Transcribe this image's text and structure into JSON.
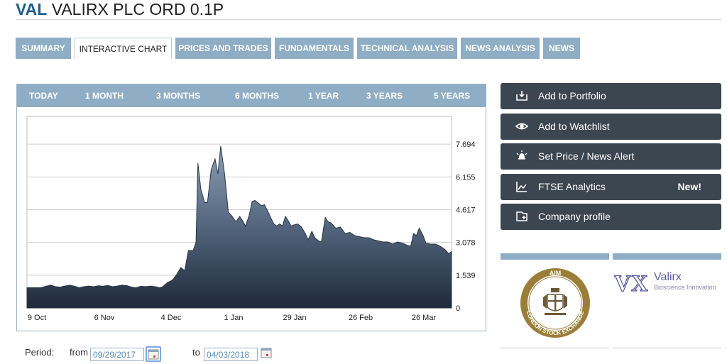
{
  "header": {
    "ticker": "VAL",
    "company": "VALIRX PLC ORD 0.1P"
  },
  "tabs": [
    {
      "label": "SUMMARY",
      "active": false
    },
    {
      "label": "INTERACTIVE CHART",
      "active": true
    },
    {
      "label": "PRICES AND TRADES",
      "active": false
    },
    {
      "label": "FUNDAMENTALS",
      "active": false
    },
    {
      "label": "TECHNICAL ANALYSIS",
      "active": false
    },
    {
      "label": "NEWS ANALYSIS",
      "active": false
    },
    {
      "label": "NEWS",
      "active": false
    }
  ],
  "ranges": [
    "TODAY",
    "1 MONTH",
    "3 MONTHS",
    "6 MONTHS",
    "1 YEAR",
    "3 YEARS",
    "5 YEARS"
  ],
  "period": {
    "label": "Period:",
    "from_label": "from",
    "from_value": "09/29/2017",
    "to_label": "to",
    "to_value": "04/03/2018"
  },
  "actions": [
    {
      "label": "Add to Portfolio",
      "icon": "add-to-portfolio-icon",
      "badge": ""
    },
    {
      "label": "Add to Watchlist",
      "icon": "eye-icon",
      "badge": ""
    },
    {
      "label": "Set Price / News Alert",
      "icon": "alert-bell-icon",
      "badge": ""
    },
    {
      "label": "FTSE Analytics",
      "icon": "analytics-chart-icon",
      "badge": "New!"
    },
    {
      "label": "Company profile",
      "icon": "company-profile-icon",
      "badge": ""
    }
  ],
  "logos": {
    "aim": {
      "top_text": "AIM",
      "ring_text": "LONDON STOCK EXCHANGE"
    },
    "valirx": {
      "mark": "VX",
      "name": "Valirx",
      "tagline": "Bioscience Innovation"
    }
  },
  "colors": {
    "accent": "#8fadc4",
    "dark_button": "#3c4651",
    "ticker": "#1d5f8c"
  },
  "chart_data": {
    "type": "area",
    "x_ticks": [
      "9 Oct",
      "6 Nov",
      "4 Dec",
      "1 Jan",
      "29 Jan",
      "26 Feb",
      "26 Mar"
    ],
    "x_tick_pos": [
      4.3,
      8.3,
      12.3,
      16.3,
      20.3,
      24.3,
      28.3
    ],
    "y_ticks": [
      "0",
      "1.539",
      "3.078",
      "4.617",
      "6.155",
      "7.694"
    ],
    "y_tick_vals": [
      0,
      1.539,
      3.078,
      4.617,
      6.155,
      7.694
    ],
    "ylim": [
      0,
      9.0
    ],
    "xlim": [
      0,
      29.1
    ],
    "points": [
      [
        0.0,
        0.95
      ],
      [
        1.5,
        0.95
      ],
      [
        2.0,
        1.02
      ],
      [
        2.5,
        1.07
      ],
      [
        3.0,
        1.0
      ],
      [
        3.5,
        0.98
      ],
      [
        4.0,
        1.03
      ],
      [
        4.5,
        1.07
      ],
      [
        5.0,
        1.02
      ],
      [
        5.5,
        0.95
      ],
      [
        6.0,
        1.0
      ],
      [
        6.5,
        1.03
      ],
      [
        7.0,
        1.0
      ],
      [
        7.5,
        1.04
      ],
      [
        8.0,
        1.02
      ],
      [
        8.5,
        1.06
      ],
      [
        9.0,
        1.0
      ],
      [
        9.5,
        1.03
      ],
      [
        10.0,
        1.07
      ],
      [
        10.5,
        1.05
      ],
      [
        11.0,
        0.98
      ],
      [
        11.5,
        0.95
      ],
      [
        12.0,
        1.02
      ],
      [
        12.5,
        1.0
      ],
      [
        13.0,
        1.03
      ],
      [
        13.5,
        1.0
      ],
      [
        14.0,
        0.95
      ],
      [
        14.3,
        1.0
      ],
      [
        14.8,
        1.2
      ],
      [
        15.3,
        1.3
      ],
      [
        15.8,
        1.6
      ],
      [
        16.2,
        1.9
      ],
      [
        16.6,
        1.75
      ],
      [
        17.0,
        2.7
      ],
      [
        17.5,
        2.7
      ],
      [
        17.8,
        3.1
      ],
      [
        18.0,
        6.8
      ],
      [
        18.3,
        5.6
      ],
      [
        18.7,
        4.95
      ],
      [
        19.0,
        4.95
      ],
      [
        19.4,
        6.5
      ],
      [
        19.8,
        7.0
      ],
      [
        20.1,
        6.3
      ],
      [
        20.4,
        7.6
      ],
      [
        20.8,
        6.3
      ],
      [
        21.2,
        4.5
      ],
      [
        21.6,
        4.3
      ],
      [
        22.0,
        4.05
      ],
      [
        22.4,
        4.3
      ],
      [
        22.7,
        4.1
      ],
      [
        23.0,
        3.85
      ],
      [
        23.4,
        4.35
      ],
      [
        23.7,
        5.0
      ],
      [
        24.0,
        5.05
      ],
      [
        24.3,
        4.95
      ],
      [
        24.7,
        4.8
      ],
      [
        25.0,
        4.85
      ],
      [
        25.4,
        4.5
      ],
      [
        25.7,
        4.2
      ],
      [
        26.0,
        3.95
      ],
      [
        26.3,
        3.85
      ],
      [
        26.6,
        3.95
      ],
      [
        26.9,
        3.85
      ],
      [
        27.2,
        4.3
      ],
      [
        27.5,
        4.1
      ],
      [
        27.8,
        3.85
      ],
      [
        28.1,
        3.9
      ],
      [
        28.5,
        3.95
      ],
      [
        28.9,
        3.8
      ],
      [
        29.3,
        3.5
      ],
      [
        29.6,
        3.2
      ],
      [
        30.0,
        3.6
      ],
      [
        30.3,
        3.3
      ],
      [
        30.7,
        3.15
      ],
      [
        31.0,
        3.1
      ],
      [
        31.4,
        4.25
      ],
      [
        31.7,
        4.05
      ],
      [
        32.0,
        4.0
      ],
      [
        32.5,
        3.75
      ],
      [
        33.0,
        3.8
      ],
      [
        33.5,
        3.5
      ],
      [
        34.0,
        3.55
      ],
      [
        34.5,
        3.4
      ],
      [
        35.0,
        3.35
      ],
      [
        35.5,
        3.3
      ],
      [
        36.0,
        3.3
      ],
      [
        36.5,
        3.2
      ],
      [
        37.0,
        3.15
      ],
      [
        37.5,
        3.1
      ],
      [
        38.0,
        3.1
      ],
      [
        38.5,
        3.0
      ],
      [
        39.0,
        3.1
      ],
      [
        39.5,
        3.05
      ],
      [
        40.0,
        2.95
      ],
      [
        40.4,
        2.9
      ],
      [
        40.7,
        3.5
      ],
      [
        41.0,
        3.4
      ],
      [
        41.3,
        3.75
      ],
      [
        41.7,
        3.4
      ],
      [
        42.0,
        3.05
      ],
      [
        42.5,
        3.0
      ],
      [
        43.0,
        3.0
      ],
      [
        43.5,
        2.9
      ],
      [
        44.0,
        2.75
      ],
      [
        44.4,
        2.55
      ],
      [
        44.7,
        2.65
      ]
    ]
  }
}
